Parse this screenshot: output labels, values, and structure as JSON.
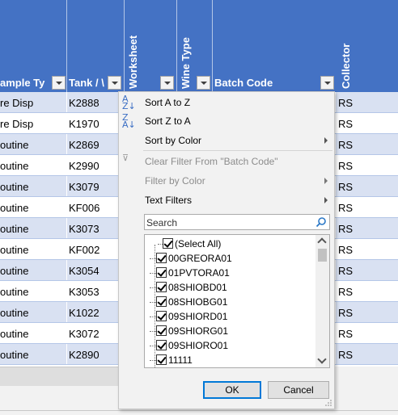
{
  "header": {
    "sample_type": "ample Ty",
    "tank": "Tank / \\",
    "worksheet": "Worksheet",
    "wine_type": "Wine Type",
    "batch_code": "Batch Code",
    "collector": "Collector"
  },
  "rows": [
    {
      "c1": "re Disp",
      "tank": "K2888",
      "collector": "RS"
    },
    {
      "c1": "re Disp",
      "tank": "K1970",
      "collector": "RS"
    },
    {
      "c1": "outine",
      "tank": "K2869",
      "collector": "RS"
    },
    {
      "c1": "outine",
      "tank": "K2990",
      "collector": "RS"
    },
    {
      "c1": "outine",
      "tank": "K3079",
      "collector": "RS"
    },
    {
      "c1": "outine",
      "tank": "KF006",
      "collector": "RS"
    },
    {
      "c1": "outine",
      "tank": "K3073",
      "collector": "RS"
    },
    {
      "c1": "outine",
      "tank": "KF002",
      "collector": "RS"
    },
    {
      "c1": "outine",
      "tank": "K3054",
      "collector": "RS"
    },
    {
      "c1": "outine",
      "tank": "K3053",
      "collector": "RS"
    },
    {
      "c1": "outine",
      "tank": "K1022",
      "collector": "RS"
    },
    {
      "c1": "outine",
      "tank": "K3072",
      "collector": "RS"
    },
    {
      "c1": "outine",
      "tank": "K2890",
      "collector": "RS"
    }
  ],
  "menu": {
    "sort_az": "Sort A to Z",
    "sort_za": "Sort Z to A",
    "sort_color": "Sort by Color",
    "clear_filter": "Clear Filter From \"Batch Code\"",
    "filter_color": "Filter by Color",
    "text_filters": "Text Filters",
    "search_placeholder": "Search",
    "items": [
      "(Select All)",
      "00GREORA01",
      "01PVTORA01",
      "08SHIOBD01",
      "08SHIOBG01",
      "09SHIORD01",
      "09SHIORG01",
      "09SHIORO01",
      "11111"
    ],
    "ok": "OK",
    "cancel": "Cancel"
  }
}
